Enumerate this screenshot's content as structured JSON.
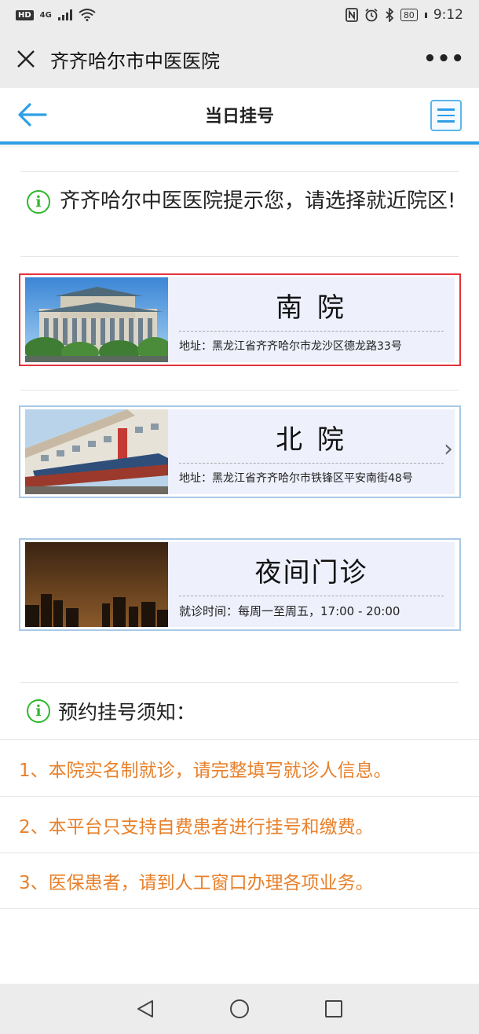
{
  "status_bar": {
    "hd": "HD",
    "network": "4G",
    "battery": "80",
    "time": "9:12"
  },
  "titlebar": {
    "title": "齐齐哈尔市中医医院",
    "more": "•••"
  },
  "header": {
    "title": "当日挂号",
    "accent_color": "#2f9fe6"
  },
  "tip": {
    "text": "齐齐哈尔中医医院提示您，请选择就近院区!"
  },
  "campuses": [
    {
      "name": "南 院",
      "detail": "地址：黑龙江省齐齐哈尔市龙沙区德龙路33号",
      "selected": true
    },
    {
      "name": "北 院",
      "detail": "地址：黑龙江省齐齐哈尔市铁锋区平安南街48号"
    },
    {
      "name": "夜间门诊",
      "detail": "就诊时间：每周一至周五，17:00 - 20:00"
    }
  ],
  "notice": {
    "title": "预约挂号须知：",
    "items": [
      "1、本院实名制就诊，请完整填写就诊人信息。",
      "2、本平台只支持自费患者进行挂号和缴费。",
      "3、医保患者，请到人工窗口办理各项业务。"
    ],
    "color": "#e8802a"
  },
  "icons": {
    "info": "i",
    "chevron": "›"
  }
}
